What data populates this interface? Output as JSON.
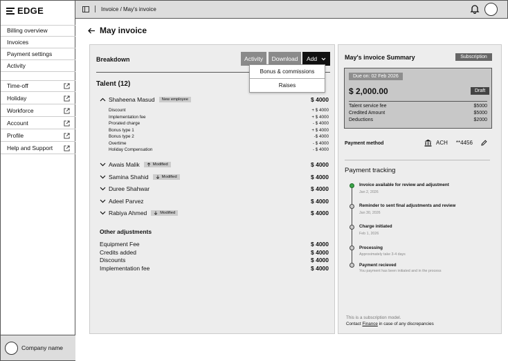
{
  "brand": {
    "name": "EDGE"
  },
  "sidebar": {
    "items": [
      {
        "label": "Billing overview",
        "external": false
      },
      {
        "label": "Invoices",
        "external": false
      },
      {
        "label": "Payment settings",
        "external": false
      },
      {
        "label": "Activity",
        "external": false
      }
    ],
    "external_items": [
      {
        "label": "Time-off"
      },
      {
        "label": "Holiday"
      },
      {
        "label": "Workforce"
      },
      {
        "label": "Account"
      },
      {
        "label": "Profile"
      },
      {
        "label": "Help and Support"
      }
    ],
    "company_name": "Company name"
  },
  "topbar": {
    "breadcrumb": "Invoice / May's invoice"
  },
  "page": {
    "title": "May invoice"
  },
  "breakdown": {
    "title": "Breakdown",
    "buttons": {
      "activity": "Activity",
      "download": "Download",
      "add": "Add"
    },
    "add_menu": [
      "Bonus & commissions",
      "Raises"
    ],
    "talent_heading": "Talent (12)",
    "talent": [
      {
        "name": "Shaheena Masud",
        "tag": "New employee",
        "tag_icon": "",
        "amount": "$ 4000",
        "expanded": true
      },
      {
        "name": "Awais Malik",
        "tag": "Modified",
        "tag_icon": "arrow-up-icon",
        "amount": "$ 4000"
      },
      {
        "name": "Samina Shahid",
        "tag": "Modified",
        "tag_icon": "arrow-down-icon",
        "amount": "$ 4000"
      },
      {
        "name": "Duree Shahwar",
        "tag": "",
        "tag_icon": "",
        "amount": "$ 4000"
      },
      {
        "name": "Adeel Parvez",
        "tag": "",
        "tag_icon": "",
        "amount": "$ 4000"
      },
      {
        "name": "Rabiya Ahmed",
        "tag": "Modified",
        "tag_icon": "arrow-down-icon",
        "amount": "$ 4000"
      }
    ],
    "details": [
      {
        "label": "Discount",
        "value": "+ $ 4000"
      },
      {
        "label": "Implementation fee",
        "value": "+ $ 4000"
      },
      {
        "label": "Prorated charge",
        "value": "- $ 4000"
      },
      {
        "label": "Bonus type 1",
        "value": "+ $ 4000"
      },
      {
        "label": "Bonus type 2",
        "value": "-$ 4000"
      },
      {
        "label": "Overtime",
        "value": "- $ 4000"
      },
      {
        "label": "Holiday Compensation",
        "value": "- $ 4000"
      }
    ],
    "other_heading": "Other adjustments",
    "adjustments": [
      {
        "label": "Equipment Fee",
        "value": "$ 4000"
      },
      {
        "label": "Credits added",
        "value": "$ 4000"
      },
      {
        "label": "Discounts",
        "value": "$ 4000"
      },
      {
        "label": "Implementation fee",
        "value": "$ 4000"
      }
    ]
  },
  "summary": {
    "title": "May's invoice Summary",
    "badge": "Subscription",
    "due": "Due on: 02 Feb 2026",
    "amount": "$ 2,000.00",
    "status": "Draft",
    "lines": [
      {
        "label": "Talent service fee",
        "value": "$5000"
      },
      {
        "label": "Credited Amount",
        "value": "$5000"
      },
      {
        "label": "Deductions",
        "value": "$2000"
      }
    ],
    "payment_method_label": "Payment method",
    "payment_method": "ACH",
    "account_mask": "**4456",
    "tracking_title": "Payment tracking",
    "steps": [
      {
        "title": "Invoice available for review and adjustment",
        "sub": "Jan 2, 2026",
        "done": true
      },
      {
        "title": "Reminder to sent final adjustments and review",
        "sub": "Jan 30, 2026",
        "done": false
      },
      {
        "title": "Charge initiated",
        "sub": "Feb 1, 2026",
        "done": false
      },
      {
        "title": "Processing",
        "sub": "Approximately take 3-4 days",
        "done": false
      },
      {
        "title": "Payment recieved",
        "sub": "You payment has been initiated and in the process",
        "done": false
      }
    ],
    "footer_note": "This is a subscription model.",
    "footer_contact_pre": "Contact",
    "footer_contact_link": "Finance",
    "footer_contact_post": "in case of any discrepancies"
  }
}
